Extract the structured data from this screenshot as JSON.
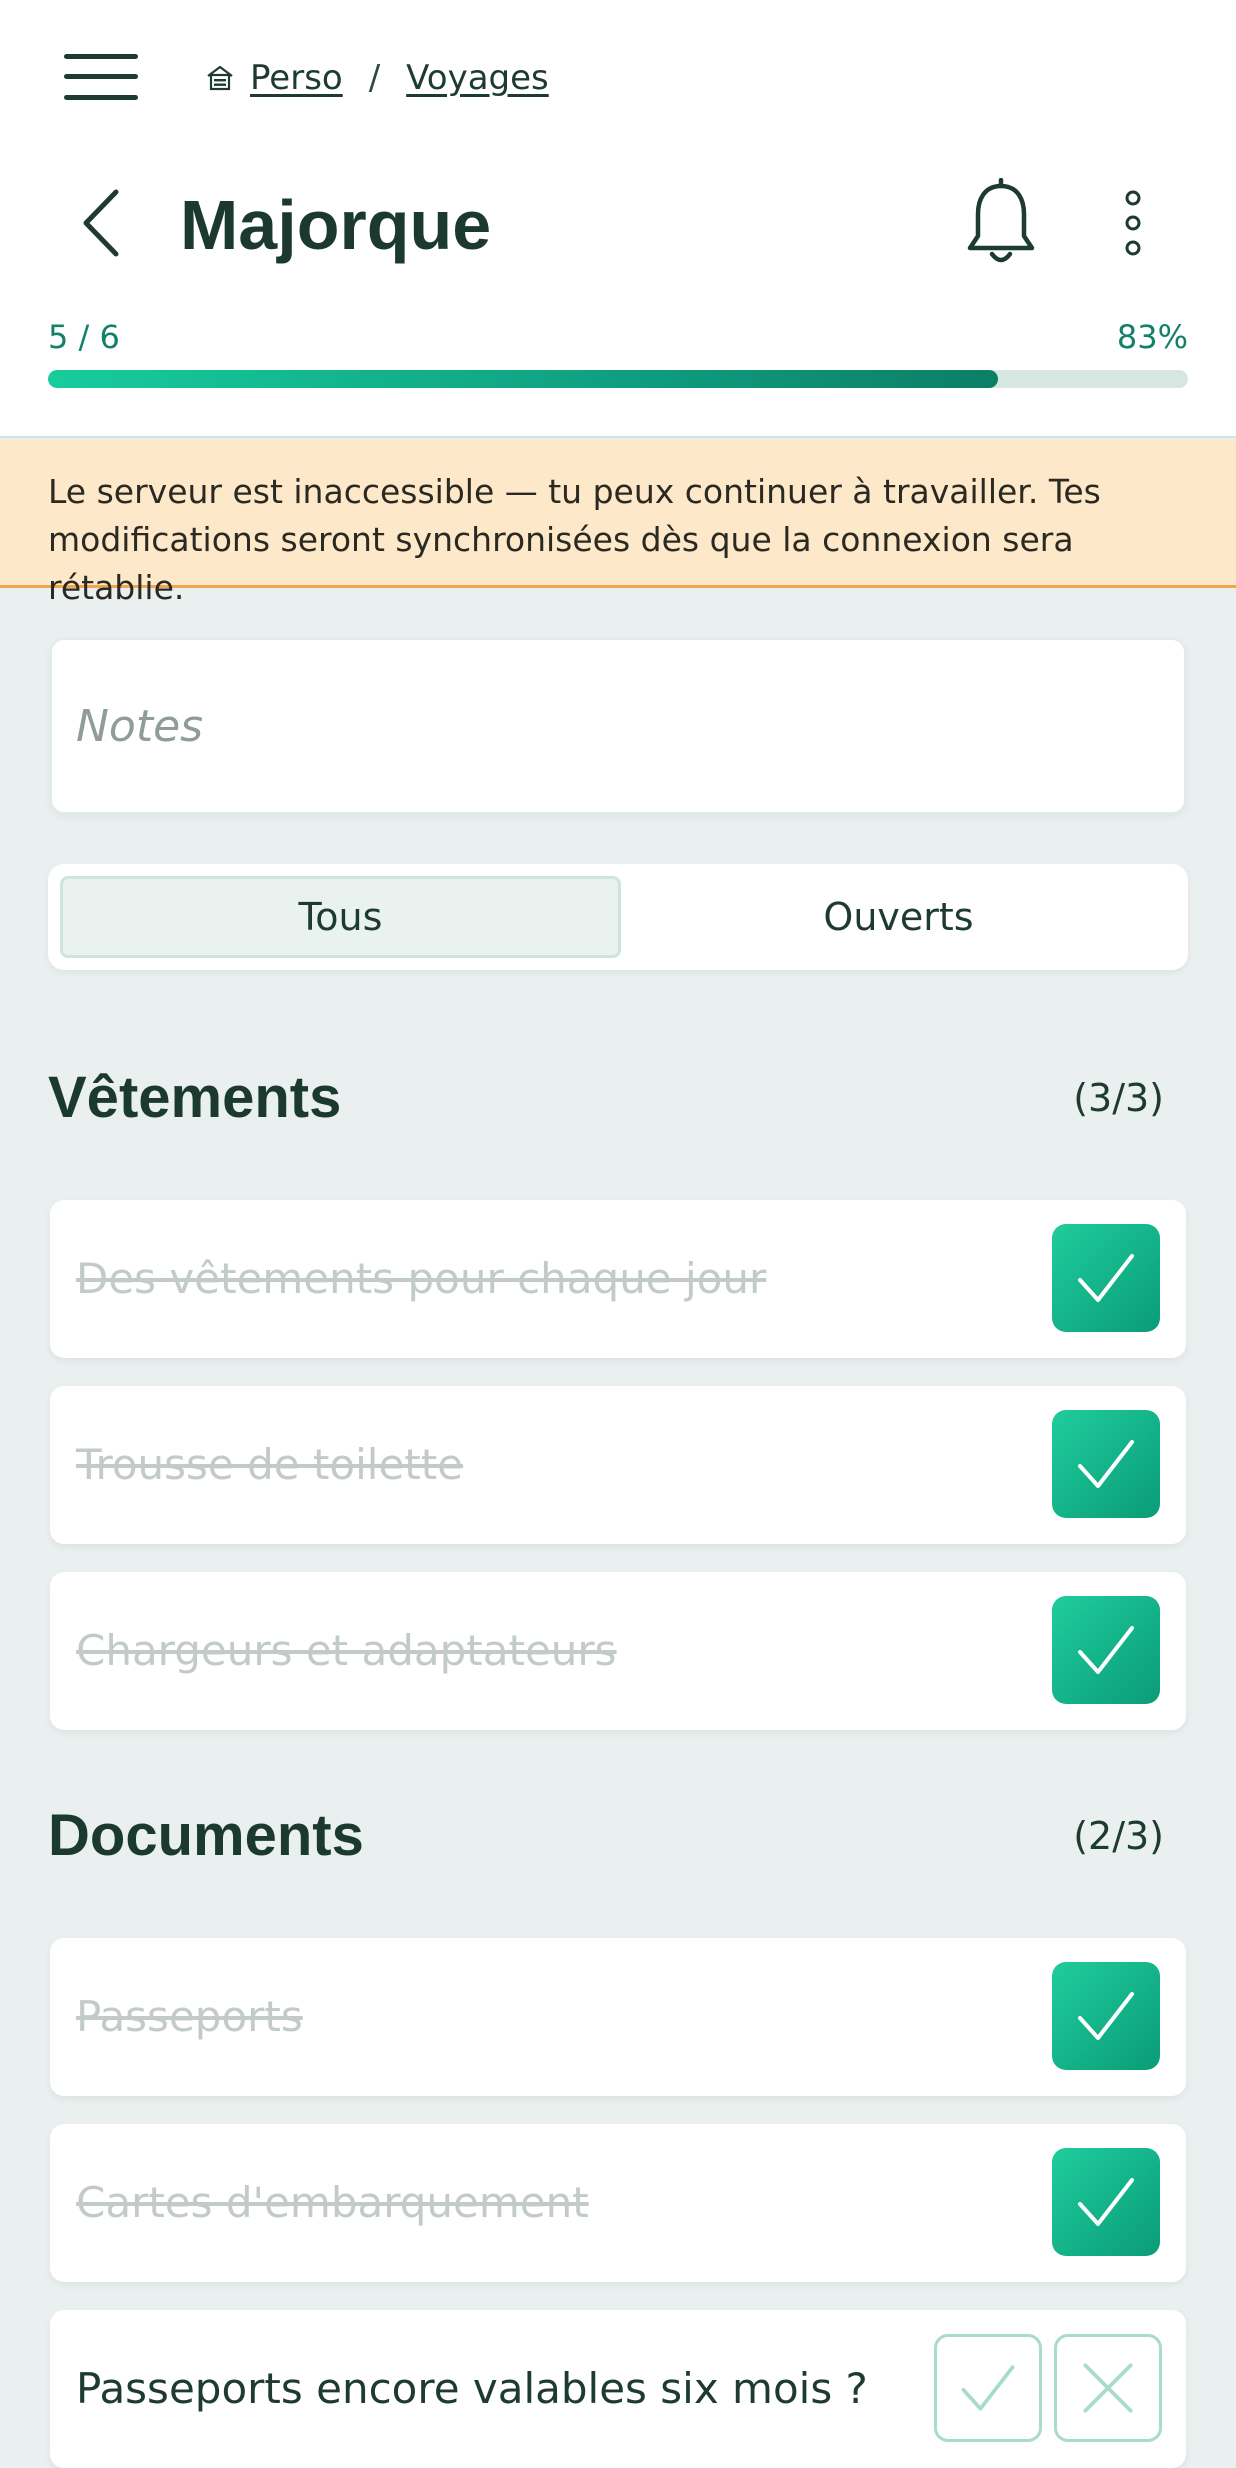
{
  "breadcrumb": {
    "home": "Perso",
    "separator": "/",
    "current": "Voyages"
  },
  "header": {
    "title": "Majorque"
  },
  "progress": {
    "count_label": "5 / 6",
    "percent_label": "83%",
    "fraction": 0.833
  },
  "banner": {
    "text": "Le serveur est inaccessible — tu peux continuer à travailler. Tes modifications seront synchronisées dès que la connexion sera rétablie."
  },
  "notes": {
    "placeholder": "Notes"
  },
  "filter": {
    "all_label": "Tous",
    "open_label": "Ouverts",
    "active": "Tous"
  },
  "sections": [
    {
      "title": "Vêtements",
      "count": "(3/3)",
      "items": [
        {
          "label": "Des vêtements pour chaque jour",
          "done": true
        },
        {
          "label": "Trousse de toilette",
          "done": true
        },
        {
          "label": "Chargeurs et adaptateurs",
          "done": true
        }
      ]
    },
    {
      "title": "Documents",
      "count": "(2/3)",
      "items": [
        {
          "label": "Passeports",
          "done": true
        },
        {
          "label": "Cartes d'embarquement",
          "done": true
        },
        {
          "label": "Passeports encore valables six mois ?",
          "done": false
        }
      ]
    }
  ],
  "icons": {
    "menu": "hamburger-icon",
    "home": "home-icon",
    "back": "chevron-left-icon",
    "notifications": "bell-icon",
    "more": "more-vertical-icon",
    "checked": "checkmark-icon",
    "reject": "x-icon"
  },
  "colors": {
    "accent": "#13a083",
    "progress_track": "#d6e6e1",
    "banner_bg": "#fde8c9",
    "banner_border": "#f2a54a",
    "page_bg": "#eaf0ef"
  }
}
